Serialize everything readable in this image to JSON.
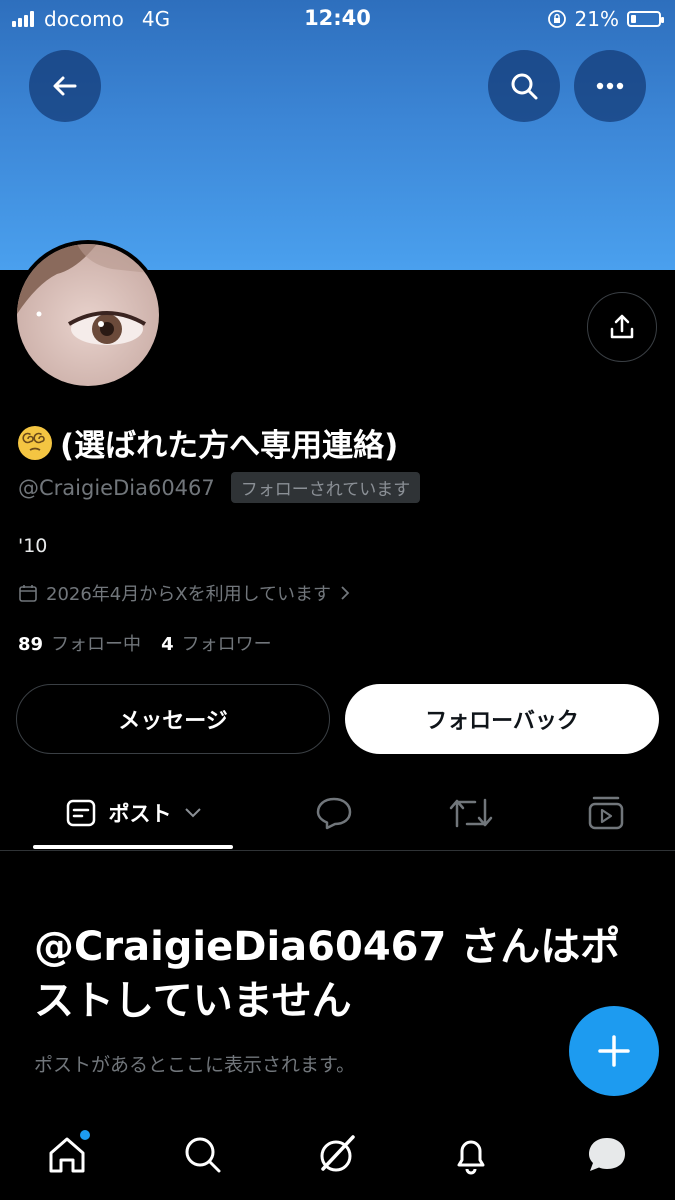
{
  "status_bar": {
    "carrier": "docomo",
    "network": "4G",
    "time": "12:40",
    "battery": "21%",
    "battery_level": 0.21
  },
  "header": {
    "back_icon": "arrow-left-icon",
    "search_icon": "search-icon",
    "more_icon": "more-horizontal-icon",
    "banner_color": "#3c86d6"
  },
  "profile": {
    "display_name": "(選ばれた方へ専用連絡)",
    "name_emoji": "dizzy-face-emoji",
    "handle": "@CraigieDia60467",
    "follows_you_badge": "フォローされています",
    "bio": "'10",
    "joined": "2026年4月からXを利用しています",
    "following_count": "89",
    "following_label": "フォロー中",
    "followers_count": "4",
    "followers_label": "フォロワー"
  },
  "actions": {
    "message_label": "メッセージ",
    "follow_back_label": "フォローバック"
  },
  "tabs": {
    "posts_label": "ポスト"
  },
  "empty_state": {
    "title": "@CraigieDia60467 さんはポストしていません",
    "subtitle": "ポストがあるとここに表示されます。"
  },
  "accent_color": "#1d9bf0"
}
